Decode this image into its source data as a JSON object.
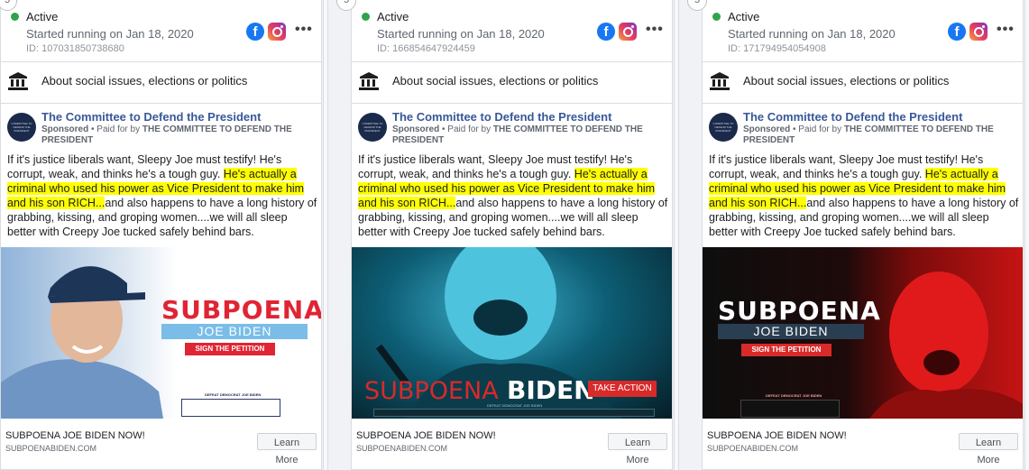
{
  "cards": [
    {
      "badge": "5",
      "status": "Active",
      "started": "Started running on Jan 18, 2020",
      "id": "ID: 107031850738680",
      "about": "About social issues, elections or politics",
      "page_name": "The Committee to Defend the President",
      "sponsored_label": "Sponsored",
      "paid_by_prefix": " • Paid for by ",
      "paid_by": "THE COMMITTEE TO DEFEND THE PRESIDENT",
      "text_before": "If it's justice liberals want, Sleepy Joe must testify! He's corrupt, weak, and thinks he's a tough guy. ",
      "text_highlight": "He's actually a criminal who used his power as Vice President to make him and his son RICH...",
      "text_after": "and also happens to have a long history of grabbing, kissing, and groping women....we will all sleep better with Creepy Joe tucked safely behind bars.",
      "creative": {
        "headline": "SUBPOENA",
        "name": "JOE BIDEN",
        "cta": "SIGN THE PETITION",
        "small": "DEFEAT DEMOCRAT JOE BIDEN"
      },
      "footer_title": "SUBPOENA JOE BIDEN NOW!",
      "footer_domain": "SUBPOENABIDEN.COM",
      "button": "Learn More"
    },
    {
      "badge": "5",
      "status": "Active",
      "started": "Started running on Jan 18, 2020",
      "id": "ID: 166854647924459",
      "about": "About social issues, elections or politics",
      "page_name": "The Committee to Defend the President",
      "sponsored_label": "Sponsored",
      "paid_by_prefix": " • Paid for by ",
      "paid_by": "THE COMMITTEE TO DEFEND THE PRESIDENT",
      "text_before": "If it's justice liberals want, Sleepy Joe must testify! He's corrupt, weak, and thinks he's a tough guy. ",
      "text_highlight": "He's actually a criminal who used his power as Vice President to make him and his son RICH...",
      "text_after": "and also happens to have a long history of grabbing, kissing, and groping women....we will all sleep better with Creepy Joe tucked safely behind bars.",
      "creative": {
        "headline": "SUBPOENA",
        "name": "BIDEN",
        "cta": "TAKE ACTION",
        "small": "DEFEAT DEMOCRAT JOE BIDEN"
      },
      "footer_title": "SUBPOENA JOE BIDEN NOW!",
      "footer_domain": "SUBPOENABIDEN.COM",
      "button": "Learn More"
    },
    {
      "badge": "5",
      "status": "Active",
      "started": "Started running on Jan 18, 2020",
      "id": "ID: 171794954054908",
      "about": "About social issues, elections or politics",
      "page_name": "The Committee to Defend the President",
      "sponsored_label": "Sponsored",
      "paid_by_prefix": " • Paid for by ",
      "paid_by": "THE COMMITTEE TO DEFEND THE PRESIDENT",
      "text_before": "If it's justice liberals want, Sleepy Joe must testify! He's corrupt, weak, and thinks he's a tough guy. ",
      "text_highlight": "He's actually a criminal who used his power as Vice President to make him and his son RICH...",
      "text_after": "and also happens to have a long history of grabbing, kissing, and groping women....we will all sleep better with Creepy Joe tucked safely behind bars.",
      "creative": {
        "headline": "SUBPOENA",
        "name": "JOE BIDEN",
        "cta": "SIGN THE PETITION",
        "small": "DEFEAT DEMOCRAT JOE BIDEN"
      },
      "footer_title": "SUBPOENA JOE BIDEN NOW!",
      "footer_domain": "SUBPOENABIDEN.COM",
      "button": "Learn More"
    }
  ],
  "colors": {
    "active": "#31a24c",
    "link": "#385898",
    "highlight": "#ffff00",
    "facebook": "#1877f2"
  }
}
